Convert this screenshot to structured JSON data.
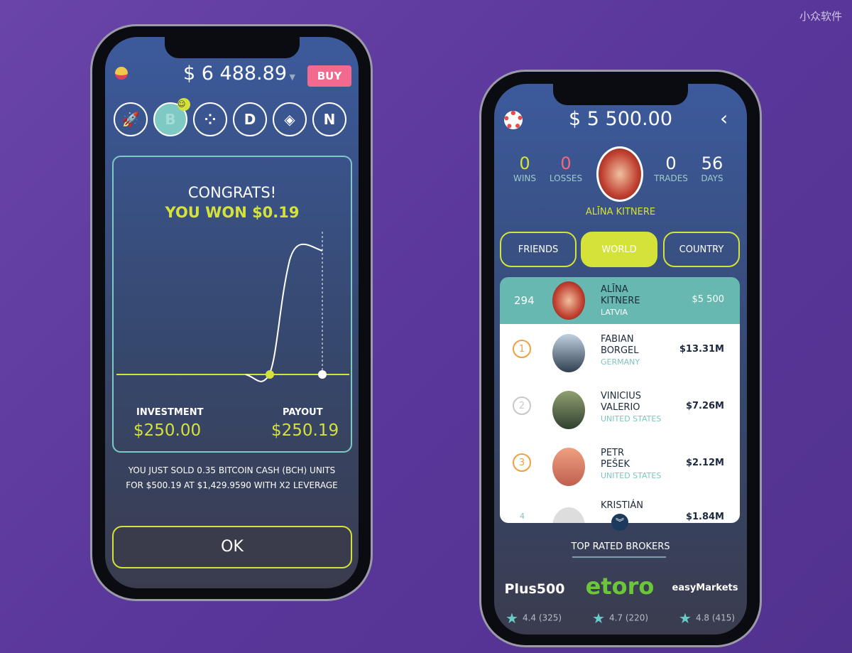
{
  "watermark": "小众软件",
  "left": {
    "balance": "$ 6 488.89",
    "buy_label": "BUY",
    "coins": [
      "rocket-icon",
      "bitcoin-cash-icon",
      "iota-icon",
      "dash-icon",
      "nem-icon",
      "neo-icon"
    ],
    "congrats": "CONGRATS!",
    "won": "YOU WON $0.19",
    "investment_label": "INVESTMENT",
    "investment_value": "$250.00",
    "payout_label": "PAYOUT",
    "payout_value": "$250.19",
    "message_line1": "YOU JUST SOLD 0.35 BITCOIN CASH (BCH) UNITS",
    "message_line2": "FOR $500.19 AT $1,429.9590 WITH X2 LEVERAGE",
    "ok_label": "OK"
  },
  "right": {
    "balance": "$ 5 500.00",
    "stats": [
      {
        "value": "0",
        "label": "WINS",
        "color": "#d4e23a"
      },
      {
        "value": "0",
        "label": "LOSSES",
        "color": "#f06a7a"
      },
      {
        "value": "0",
        "label": "TRADES",
        "color": "#ffffff"
      },
      {
        "value": "56",
        "label": "DAYS",
        "color": "#ffffff"
      }
    ],
    "user_name": "ALĪNA KITNERE",
    "tabs": [
      "FRIENDS",
      "WORLD",
      "COUNTRY"
    ],
    "active_tab": "WORLD",
    "me": {
      "rank": "294",
      "first": "ALĪNA",
      "last": "KITNERE",
      "country": "LATVIA",
      "amount": "$5 500"
    },
    "leaders": [
      {
        "rank": "1",
        "first": "FABIAN",
        "last": "BORGEL",
        "country": "GERMANY",
        "amount": "$13.31M",
        "medal": "#f0a040"
      },
      {
        "rank": "2",
        "first": "VINICIUS",
        "last": "VALERIO",
        "country": "UNITED STATES",
        "amount": "$7.26M",
        "medal": "#c8c8c8"
      },
      {
        "rank": "3",
        "first": "PETR",
        "last": "PEŠEK",
        "country": "UNITED STATES",
        "amount": "$2.12M",
        "medal": "#f0a040"
      },
      {
        "rank": "4",
        "first": "KRISTIÁN",
        "last": "",
        "country": "",
        "amount": "$1.84M",
        "medal": "#7fc4bf"
      }
    ],
    "brokers_title": "TOP RATED BROKERS",
    "brokers": [
      {
        "name": "Plus500",
        "rating": "4.4 (325)"
      },
      {
        "name": "etoro",
        "rating": "4.7 (220)"
      },
      {
        "name": "easyMarkets",
        "rating": "4.8 (415)"
      }
    ]
  }
}
